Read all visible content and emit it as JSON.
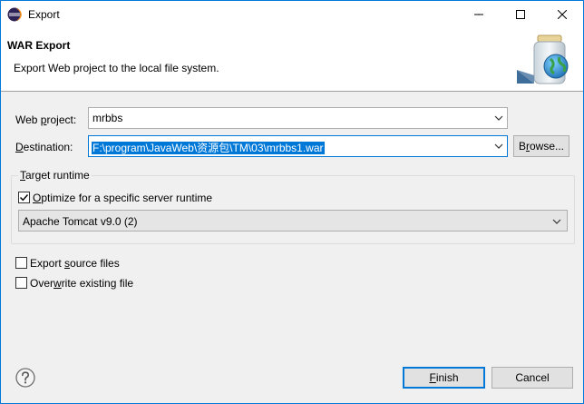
{
  "window": {
    "title": "Export",
    "colors": {
      "accent": "#0078d7",
      "titlebar": "#ffffff",
      "body": "#f0f0f0"
    }
  },
  "header": {
    "title": "WAR Export",
    "description": "Export Web project to the local file system."
  },
  "form": {
    "web_project": {
      "label_pre": "Web ",
      "label_key": "p",
      "label_post": "roject:",
      "value": "mrbbs"
    },
    "destination": {
      "label_pre": "",
      "label_key": "D",
      "label_post": "estination:",
      "value": "F:\\program\\JavaWeb\\资源包\\TM\\03\\mrbbs1.war"
    },
    "browse": {
      "label_pre": "B",
      "label_key": "r",
      "label_post": "owse..."
    }
  },
  "runtime": {
    "group_title_key": "T",
    "group_title_rest": "arget runtime",
    "optimize": {
      "label_pre": "",
      "label_key": "O",
      "label_post": "ptimize for a specific server runtime",
      "checked": true
    },
    "server": "Apache Tomcat v9.0 (2)"
  },
  "options": {
    "export_source": {
      "label_pre": "Export ",
      "label_key": "s",
      "label_post": "ource files",
      "checked": false
    },
    "overwrite": {
      "label_pre": "Over",
      "label_key": "w",
      "label_post": "rite existing file",
      "checked": false
    }
  },
  "footer": {
    "finish": {
      "label_pre": "",
      "label_key": "F",
      "label_post": "inish"
    },
    "cancel": "Cancel"
  }
}
